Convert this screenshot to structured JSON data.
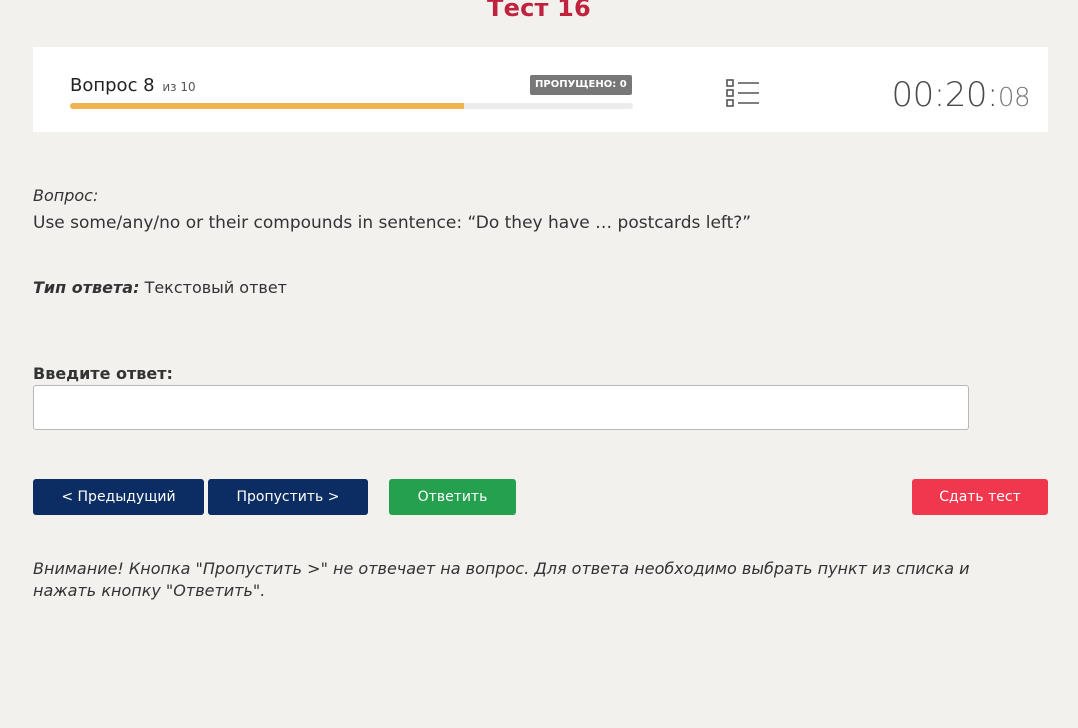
{
  "header": {
    "title": "Тест 16"
  },
  "status": {
    "question_word": "Вопрос 8",
    "question_of": "из 10",
    "current_question": 8,
    "total_questions": 10,
    "skipped_label": "ПРОПУЩЕНО: 0",
    "progress_fraction": 0.7,
    "progress_color": "#f0b44c",
    "question_list_icon": "list-icon",
    "timer_main": "00:20:",
    "timer_seconds": "08"
  },
  "question": {
    "label": "Вопрос:",
    "text": "Use some/any/no or their compounds in sentence: “Do they have … postcards left?”",
    "answer_type_key": "Тип ответа:",
    "answer_type_value": "Текстовый ответ"
  },
  "answer": {
    "label": "Введите ответ:",
    "value": "",
    "placeholder": ""
  },
  "buttons": {
    "prev_label": "< Предыдущий",
    "skip_label": "Пропустить >",
    "answer_label": "Ответить",
    "submit_label": "Сдать тест"
  },
  "colors": {
    "title": "#c0223d",
    "nav_button": "#0b2d63",
    "answer_button": "#25a04e",
    "submit_button": "#f0374d",
    "badge": "#777777"
  },
  "notice": {
    "text": "Внимание! Кнопка \"Пропустить >\" не отвечает на вопрос. Для ответа необходимо выбрать пункт из списка и нажать кнопку \"Ответить\"."
  }
}
